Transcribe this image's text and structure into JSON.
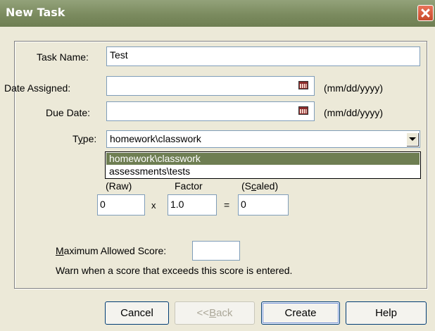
{
  "window": {
    "title": "New Task"
  },
  "form": {
    "task_name_label": "Task Name:",
    "task_name_value": "Test",
    "date_assigned_label": "Date Assigned:",
    "date_assigned_value": "",
    "date_format_1": "(mm/dd/yyyy)",
    "due_date_label": "Due Date:",
    "due_date_value": "",
    "date_format_2": "(mm/dd/yyyy)",
    "type_label_pre": "T",
    "type_label_u": "y",
    "type_label_post": "pe:",
    "type_value": "homework\\classwork",
    "type_options": [
      "homework\\classwork",
      "assessments\\tests"
    ],
    "raw_label": "(Raw)",
    "factor_label": "Factor",
    "scaled_label_pre": "(S",
    "scaled_label_u": "c",
    "scaled_label_post": "aled)",
    "raw_value": "0",
    "times_symbol": "x",
    "factor_value": "1.0",
    "equals_symbol": "=",
    "scaled_value": "0",
    "max_score_label_u": "M",
    "max_score_label_post": "aximum Allowed Score:",
    "max_score_value": "",
    "warn_text": "Warn when a score that exceeds this score is entered."
  },
  "buttons": {
    "cancel": "Cancel",
    "back_pre": "<<",
    "back_u": "B",
    "back_post": "ack",
    "create": "Create",
    "help": "Help"
  }
}
